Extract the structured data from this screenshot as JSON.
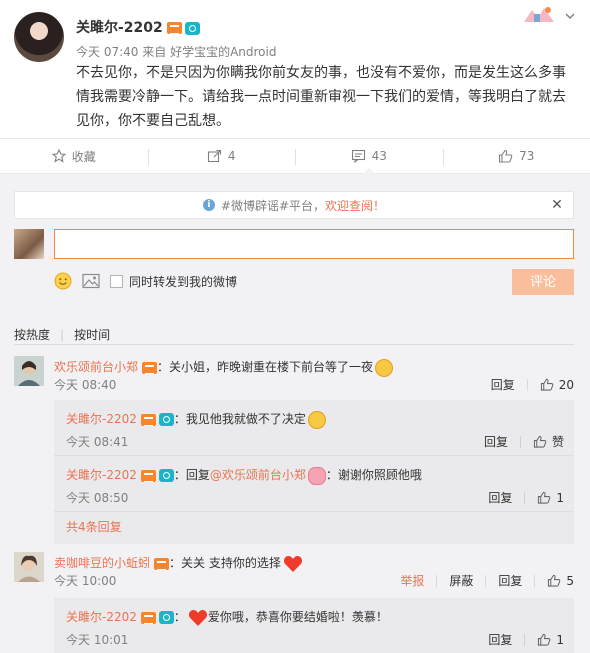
{
  "post": {
    "username": "关雎尔-2202",
    "time": "今天 07:40",
    "source_prefix": "来自",
    "source": "好学宝宝的Android",
    "content": "不去见你，不是只因为你瞒我你前女友的事，也没有不爱你，而是发生这么多事情我需要冷静一下。请给我一点时间重新审视一下我们的爱情，等我明白了就去见你，你不要自己乱想。"
  },
  "actions": [
    {
      "label": "收藏",
      "icon": "star-icon"
    },
    {
      "label": "4",
      "icon": "repost-icon"
    },
    {
      "label": "43",
      "icon": "comment-icon"
    },
    {
      "label": "73",
      "icon": "thumbs-up-icon"
    }
  ],
  "notice": {
    "prefix": "#微博辟谣#平台，",
    "highlight": "欢迎查阅！"
  },
  "composer": {
    "input_value": "",
    "repost_label": "同时转发到我的微博",
    "submit_label": "评论"
  },
  "sort": {
    "by_hot": "按热度",
    "by_time": "按时间"
  },
  "comments": [
    {
      "user": "欢乐颂前台小郑",
      "text": "：关小姐，昨晚谢重在楼下前台等了一夜",
      "time": "今天 08:40",
      "reply": "回复",
      "likes": "20",
      "replies": [
        {
          "user": "关雎尔-2202",
          "text": "：我见他我就做不了决定",
          "time": "今天 08:41",
          "reply": "回复",
          "likes": "赞"
        },
        {
          "user": "关雎尔-2202",
          "text_prefix": "：回复",
          "mention": "@欢乐颂前台小郑",
          "text": "：谢谢你照顾他哦",
          "time": "今天 08:50",
          "reply": "回复",
          "likes": "1"
        }
      ],
      "more": "共4条回复"
    },
    {
      "user": "卖咖啡豆的小蚯蚓",
      "text": "：关关 支持你的选择",
      "time": "今天 10:00",
      "report": "举报",
      "block": "屏蔽",
      "reply": "回复",
      "likes": "5",
      "replies": [
        {
          "user": "关雎尔-2202",
          "text": "爱你哦，恭喜你要结婚啦！羡慕！",
          "time": "今天 10:01",
          "reply": "回复",
          "likes": "1"
        }
      ]
    }
  ],
  "colors": {
    "accent": "#eb7350",
    "vip": "#f6852e",
    "camera_badge": "#1bb5c8",
    "background": "#f2f2f5",
    "submit_disabled": "#fbbe9c"
  }
}
